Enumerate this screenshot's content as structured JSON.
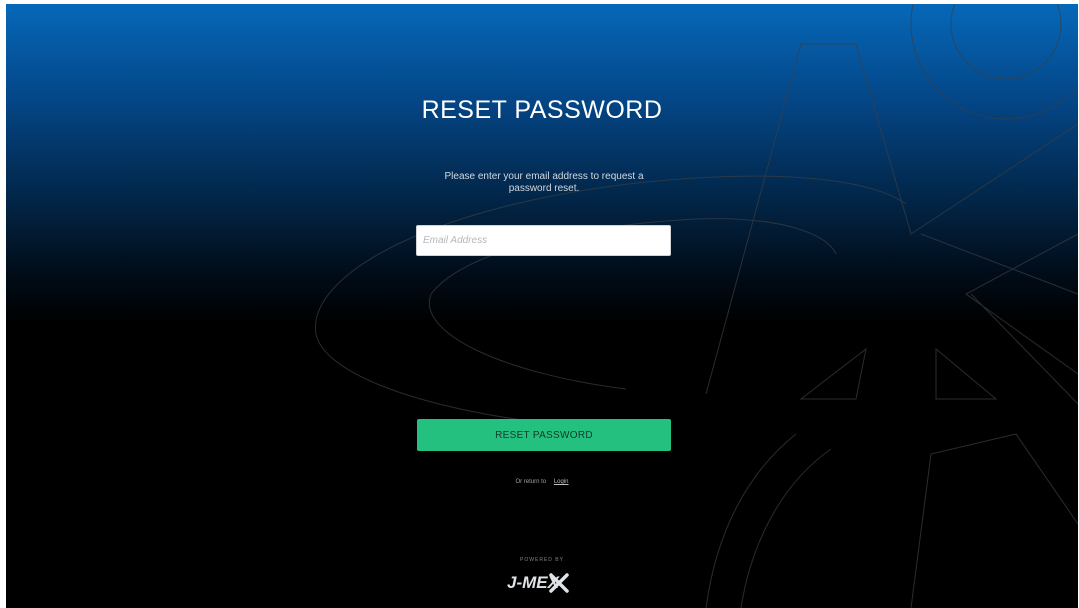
{
  "page": {
    "title": "RESET PASSWORD",
    "instructions": "Please enter your email address to request a password reset."
  },
  "form": {
    "email_placeholder": "Email Address",
    "email_value": "",
    "submit_label": "RESET PASSWORD"
  },
  "footer": {
    "return_text": "Or return to",
    "login_link": "Login",
    "powered_by": "POWERED BY",
    "brand": "J-MEX"
  },
  "colors": {
    "gradient_top": "#0668b8",
    "background": "#000000",
    "button": "#24c07f",
    "title_text": "#ffffff"
  },
  "icons": {
    "brand_logo": "jmex-logo-icon",
    "background_mark": "background-x-logo-watermark"
  }
}
